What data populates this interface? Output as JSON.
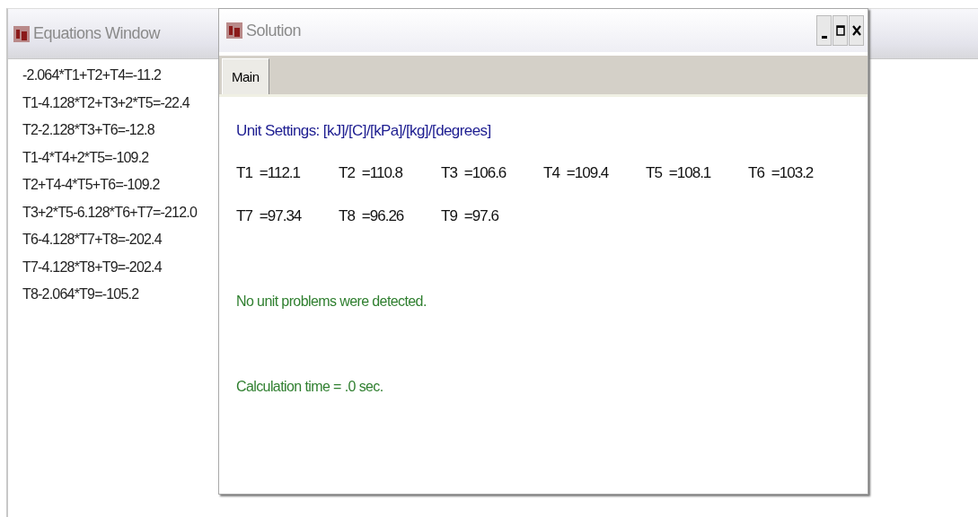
{
  "equations_window": {
    "title": "Equations Window",
    "equations": [
      "-2.064*T1+T2+T4=-11.2",
      "T1-4.128*T2+T3+2*T5=-22.4",
      "T2-2.128*T3+T6=-12.8",
      "T1-4*T4+2*T5=-109.2",
      "T2+T4-4*T5+T6=-109.2",
      "T3+2*T5-6.128*T6+T7=-212.0",
      "T6-4.128*T7+T8=-202.4",
      "T7-4.128*T8+T9=-202.4",
      "T8-2.064*T9=-105.2"
    ]
  },
  "solution_window": {
    "title": "Solution",
    "tabs": [
      {
        "label": "Main",
        "selected": true
      }
    ],
    "unit_settings": "Unit Settings: [kJ]/[C]/[kPa]/[kg]/[degrees]",
    "variables": [
      {
        "name": "T1",
        "value": "=112.1"
      },
      {
        "name": "T2",
        "value": "=110.8"
      },
      {
        "name": "T3",
        "value": "=106.6"
      },
      {
        "name": "T4",
        "value": "=109.4"
      },
      {
        "name": "T5",
        "value": "=108.1"
      },
      {
        "name": "T6",
        "value": "=103.2"
      },
      {
        "name": "T7",
        "value": "=97.34"
      },
      {
        "name": "T8",
        "value": "=96.26"
      },
      {
        "name": "T9",
        "value": "=97.6"
      }
    ],
    "messages": [
      "No unit problems were detected.",
      "Calculation time = .0 sec."
    ]
  }
}
